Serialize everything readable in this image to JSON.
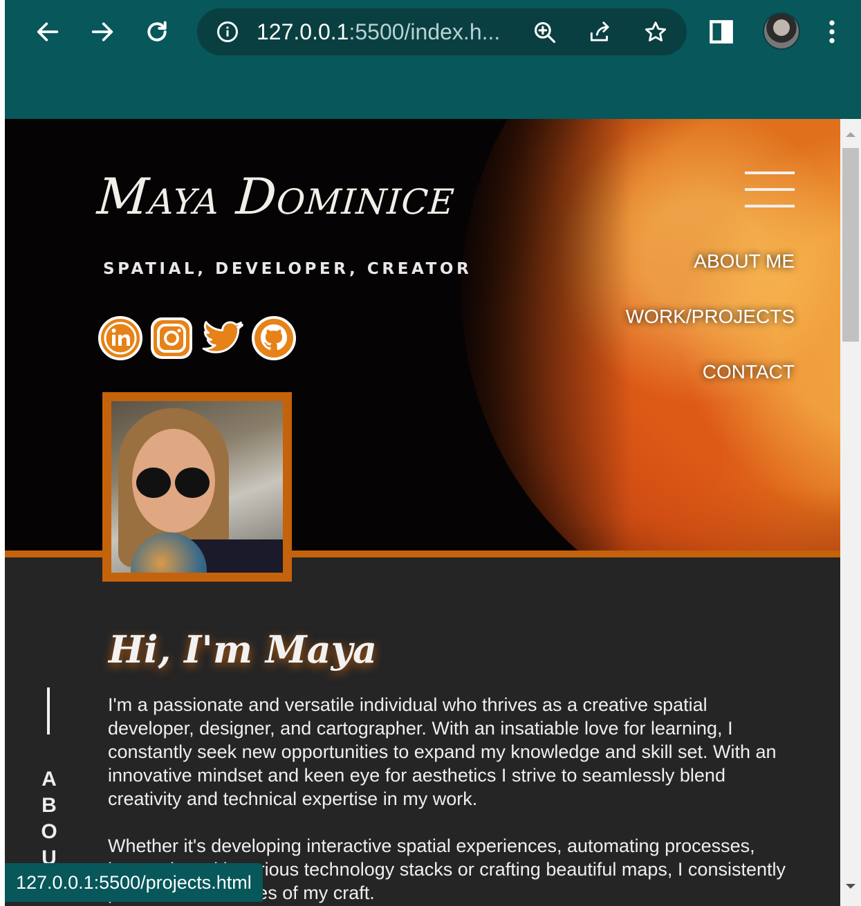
{
  "browser": {
    "url_host": "127.0.0.1",
    "url_rest": ":5500/index.h...",
    "back_icon": "arrow-left-icon",
    "forward_icon": "arrow-right-icon",
    "reload_icon": "reload-icon",
    "colors": {
      "toolbar": "#07575b",
      "omnibox": "#0a3f42"
    }
  },
  "header": {
    "title": "Maya Dominice",
    "tagline": "SPATIAL, DEVELOPER, CREATOR",
    "socials": [
      "linkedin-icon",
      "instagram-icon",
      "twitter-icon",
      "github-icon"
    ]
  },
  "menu": {
    "items": [
      "ABOUT ME",
      "WORK/PROJECTS",
      "CONTACT"
    ]
  },
  "about": {
    "heading": "Hi, I'm Maya",
    "side_label": [
      "A",
      "B",
      "O",
      "U"
    ],
    "paragraphs": [
      "I'm a passionate and versatile individual who thrives as a creative spatial developer, designer, and cartographer. With an insatiable love for learning, I constantly seek new opportunities to expand my knowledge and skill set. With an innovative mindset and keen eye for aesthetics I strive to seamlessly blend creativity and technical expertise in my work.",
      "Whether it's developing interactive spatial experiences, automating processes, integrating with various technology stacks or crafting beautiful maps, I consistently push the boundaries of my craft."
    ]
  },
  "status_bar": {
    "text": "127.0.0.1:5500/projects.html"
  },
  "colors": {
    "accent": "#c5620c",
    "page_bg": "#252525",
    "hero_bg": "#050303"
  }
}
